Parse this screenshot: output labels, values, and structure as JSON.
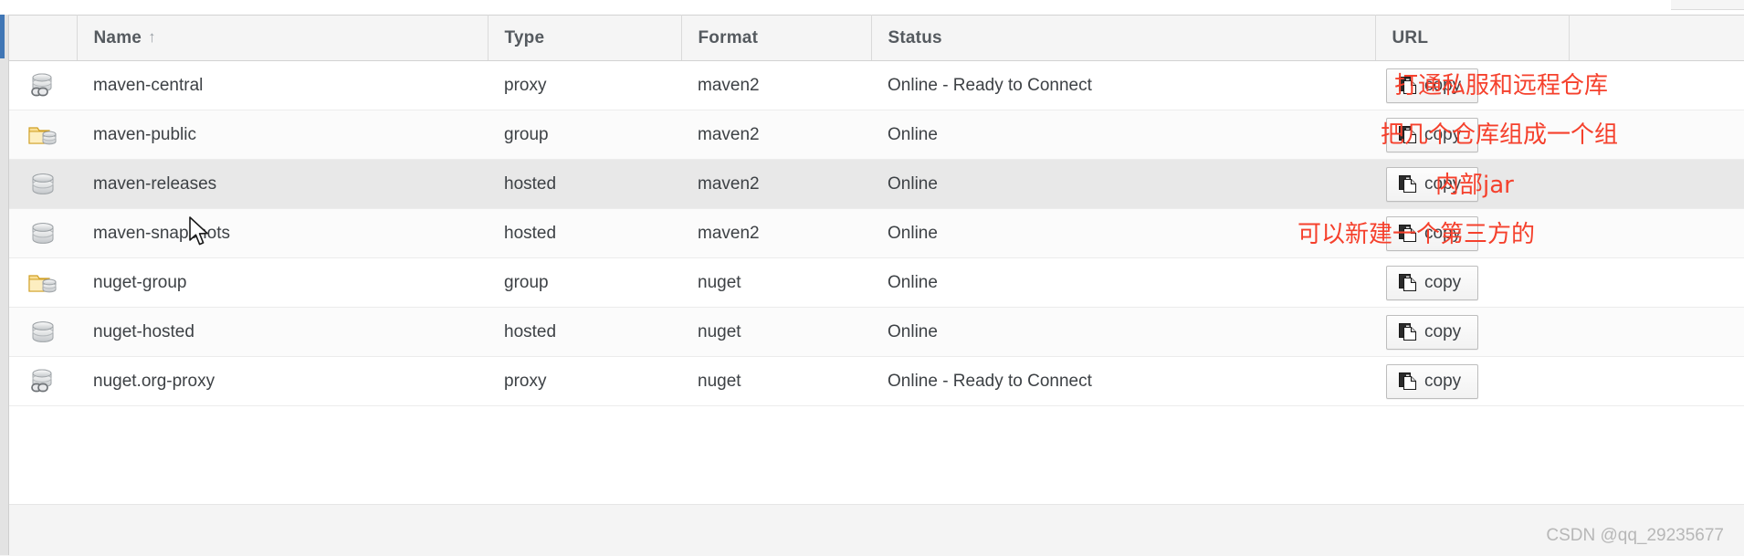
{
  "table": {
    "columns": [
      {
        "key": "icon",
        "label": "",
        "sorted": false
      },
      {
        "key": "name",
        "label": "Name",
        "sorted": true,
        "sort_direction": "asc",
        "sort_glyph": "↑"
      },
      {
        "key": "type",
        "label": "Type",
        "sorted": false
      },
      {
        "key": "format",
        "label": "Format",
        "sorted": false
      },
      {
        "key": "status",
        "label": "Status",
        "sorted": false
      },
      {
        "key": "url",
        "label": "URL",
        "sorted": false
      },
      {
        "key": "extra",
        "label": "",
        "sorted": false
      }
    ],
    "copy_button_label": "copy",
    "rows": [
      {
        "icon": "database-link-icon",
        "name": "maven-central",
        "type": "proxy",
        "format": "maven2",
        "status": "Online - Ready to Connect",
        "copy": "copy",
        "highlighted": false
      },
      {
        "icon": "folder-database-icon",
        "name": "maven-public",
        "type": "group",
        "format": "maven2",
        "status": "Online",
        "copy": "copy",
        "highlighted": false
      },
      {
        "icon": "database-icon",
        "name": "maven-releases",
        "type": "hosted",
        "format": "maven2",
        "status": "Online",
        "copy": "copy",
        "highlighted": true
      },
      {
        "icon": "database-icon",
        "name": "maven-snapshots",
        "type": "hosted",
        "format": "maven2",
        "status": "Online",
        "copy": "copy",
        "highlighted": false
      },
      {
        "icon": "folder-database-icon",
        "name": "nuget-group",
        "type": "group",
        "format": "nuget",
        "status": "Online",
        "copy": "copy",
        "highlighted": false
      },
      {
        "icon": "database-icon",
        "name": "nuget-hosted",
        "type": "hosted",
        "format": "nuget",
        "status": "Online",
        "copy": "copy",
        "highlighted": false
      },
      {
        "icon": "database-link-icon",
        "name": "nuget.org-proxy",
        "type": "proxy",
        "format": "nuget",
        "status": "Online - Ready to Connect",
        "copy": "copy",
        "highlighted": false
      }
    ]
  },
  "annotations": [
    {
      "text": "打通私服和远程仓库",
      "color": "#f5402c"
    },
    {
      "text": "把几个仓库组成一个组",
      "color": "#f5402c"
    },
    {
      "text": "内部jar",
      "color": "#f5402c"
    },
    {
      "text": "可以新建一个第三方的",
      "color": "#f5402c"
    }
  ],
  "watermark": {
    "text": "CSDN @qq_29235677"
  },
  "colors": {
    "accent": "#4076b5",
    "header_bg": "#f5f5f5",
    "row_hover": "#e8e8e8",
    "annotation_red": "#f5402c",
    "folder_yellow": "#e8b33c",
    "database_gray": "#c9ccce"
  }
}
